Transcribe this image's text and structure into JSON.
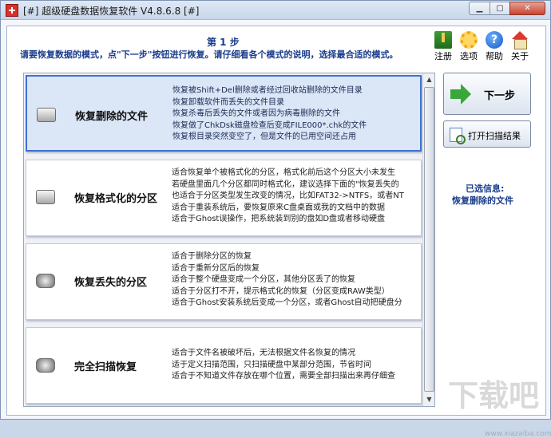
{
  "window": {
    "title": "[#] 超级硬盘数据恢复软件 V4.8.6.8 [#]",
    "minimize_glyph": "▁",
    "maximize_glyph": "▢",
    "close_glyph": "✕"
  },
  "header": {
    "step_title": "第 1 步",
    "instruction": "请要恢复数据的模式，点\"下一步\"按钮进行恢复。请仔细看各个模式的说明，选择最合适的模式。"
  },
  "toolbar": {
    "items": [
      {
        "label": "注册",
        "icon": "register-icon"
      },
      {
        "label": "选项",
        "icon": "options-icon"
      },
      {
        "label": "帮助",
        "icon": "help-icon",
        "glyph": "?"
      },
      {
        "label": "关于",
        "icon": "about-icon"
      }
    ]
  },
  "modes": [
    {
      "name": "恢复删除的文件",
      "selected": true,
      "icon": "hard-drive-icon",
      "lines": [
        "恢复被Shift+Del删除或者经过回收站删除的文件目录",
        "恢复卸载软件而丢失的文件目录",
        "恢复杀毒后丢失的文件或者因为病毒删除的文件",
        "恢复做了ChkDsk磁盘检查后变成FILE000*.chk的文件",
        "恢复根目录突然变空了，但是文件的已用空间还占用"
      ]
    },
    {
      "name": "恢复格式化的分区",
      "selected": false,
      "icon": "hard-drive-icon",
      "lines": [
        "适合恢复单个被格式化的分区，格式化前后这个分区大小未发生",
        "若硬盘里面几个分区都同时格式化，建议选择下面的\"恢复丢失的",
        "也适合于分区类型发生改变的情况，比如FAT32->NTFS，或者NT",
        "适合于重装系统后，要恢复原来C盘桌面或我的文档中的数据",
        "适合于Ghost误操作，把系统装到别的盘如D盘或者移动硬盘"
      ]
    },
    {
      "name": "恢复丢失的分区",
      "selected": false,
      "icon": "disk-platter-icon",
      "lines": [
        "适合于删除分区的恢复",
        "适合于重新分区后的恢复",
        "适合于整个硬盘变成一个分区，其他分区丢了的恢复",
        "适合于分区打不开，提示格式化的恢复（分区变成RAW类型）",
        "适合于Ghost安装系统后变成一个分区，或者Ghost自动把硬盘分"
      ]
    },
    {
      "name": "完全扫描恢复",
      "selected": false,
      "icon": "disk-platter-icon",
      "lines": [
        "适合于文件名被破坏后，无法根据文件名恢复的情况",
        "适于定义扫描范围，只扫描硬盘中某部分范围，节省时间",
        "适合于不知道文件存放在哪个位置，需要全部扫描出来再仔细查"
      ]
    }
  ],
  "scrollbar": {
    "up_glyph": "▲",
    "down_glyph": "▼"
  },
  "actions": {
    "next_label": "下一步",
    "open_scan_label": "打开扫描结果"
  },
  "selection_info": {
    "heading": "已选信息:",
    "value": "恢复删除的文件"
  },
  "watermark": {
    "text": "下载吧",
    "url": "www.xiazaiba.com"
  }
}
